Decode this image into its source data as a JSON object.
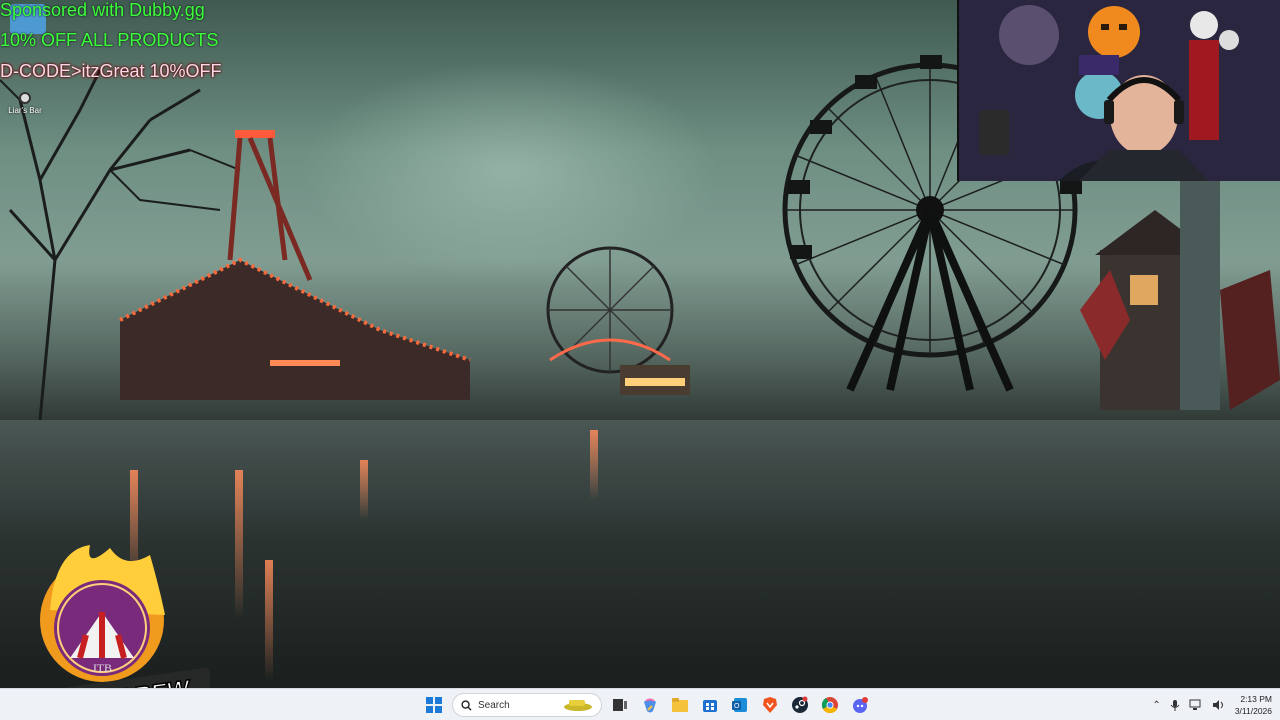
{
  "overlay": {
    "line1": "Sponsored with Dubby.gg",
    "line2": "10% OFF ALL PRODUCTS",
    "line3": "D-CODE>itzGreat 10%OFF"
  },
  "desktop_icons": [
    {
      "label": "Liar's Bar"
    }
  ],
  "logo": {
    "brand_text": "TOP GREW",
    "emblem_text": "JTB"
  },
  "taskbar": {
    "search_placeholder": "Search",
    "pinned": [
      "windows-start",
      "search",
      "task-view",
      "copilot",
      "file-explorer",
      "microsoft-store",
      "outlook",
      "brave",
      "steam",
      "chrome",
      "discord"
    ],
    "tray": {
      "time": "2:13 PM",
      "date": "3/11/2026"
    }
  },
  "colors": {
    "overlay_green": "#3bff3b",
    "overlay_pink": "#ffd6e6",
    "taskbar_bg": "#eef1f5"
  }
}
